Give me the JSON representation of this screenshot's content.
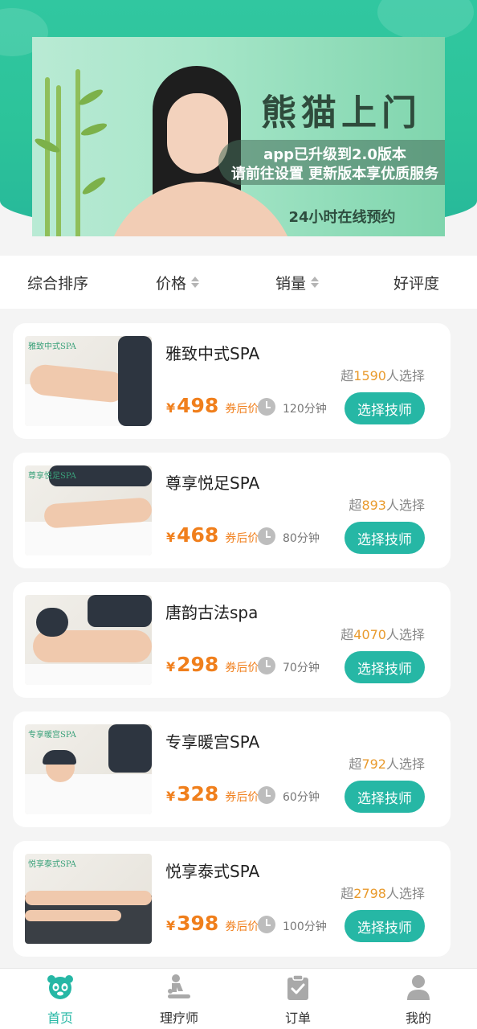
{
  "banner": {
    "brand": "熊猫上门",
    "line1": "app已升级到2.0版本",
    "line2": "请前往设置 更新版本享优质服务",
    "subtitle": "24小时在线预约"
  },
  "sort": {
    "items": [
      {
        "label": "综合排序"
      },
      {
        "label": "价格"
      },
      {
        "label": "销量"
      },
      {
        "label": "好评度"
      }
    ]
  },
  "services": [
    {
      "title": "雅致中式SPA",
      "sold_prefix": "超",
      "sold_count": "1590",
      "sold_suffix": "人选择",
      "yen": "¥",
      "price": "498",
      "price_suffix": "券后价",
      "duration": "120分钟",
      "button": "选择技师",
      "thumb_tag": "雅致中式SPA"
    },
    {
      "title": "尊享悦足SPA",
      "sold_prefix": "超",
      "sold_count": "893",
      "sold_suffix": "人选择",
      "yen": "¥",
      "price": "468",
      "price_suffix": "券后价",
      "duration": "80分钟",
      "button": "选择技师",
      "thumb_tag": "尊享悦足SPA"
    },
    {
      "title": "唐韵古法spa",
      "sold_prefix": "超",
      "sold_count": "4070",
      "sold_suffix": "人选择",
      "yen": "¥",
      "price": "298",
      "price_suffix": "券后价",
      "duration": "70分钟",
      "button": "选择技师",
      "thumb_tag": ""
    },
    {
      "title": "专享暖宫SPA",
      "sold_prefix": "超",
      "sold_count": "792",
      "sold_suffix": "人选择",
      "yen": "¥",
      "price": "328",
      "price_suffix": "券后价",
      "duration": "60分钟",
      "button": "选择技师",
      "thumb_tag": "专享暖宫SPA"
    },
    {
      "title": "悦享泰式SPA",
      "sold_prefix": "超",
      "sold_count": "2798",
      "sold_suffix": "人选择",
      "yen": "¥",
      "price": "398",
      "price_suffix": "券后价",
      "duration": "100分钟",
      "button": "选择技师",
      "thumb_tag": "悦享泰式SPA"
    }
  ],
  "tabs": [
    {
      "label": "首页",
      "icon": "panda-home-icon",
      "active": true
    },
    {
      "label": "理疗师",
      "icon": "therapist-icon",
      "active": false
    },
    {
      "label": "订单",
      "icon": "order-clipboard-icon",
      "active": false
    },
    {
      "label": "我的",
      "icon": "user-profile-icon",
      "active": false
    }
  ],
  "colors": {
    "accent": "#26b7a5",
    "price": "#f07f1c",
    "sold_count": "#e99a2c",
    "header_green": "#2cc39a"
  }
}
